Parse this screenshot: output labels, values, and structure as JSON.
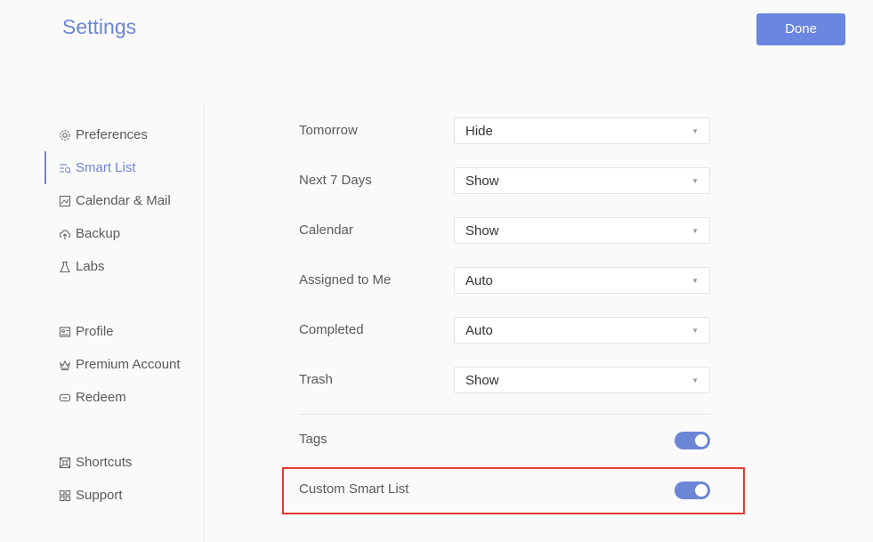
{
  "header": {
    "title": "Settings",
    "done_label": "Done"
  },
  "sidebar": {
    "items": [
      {
        "label": "Preferences",
        "icon": "gear-icon"
      },
      {
        "label": "Smart List",
        "icon": "smart-list-icon",
        "active": true
      },
      {
        "label": "Calendar & Mail",
        "icon": "calendar-mail-icon"
      },
      {
        "label": "Backup",
        "icon": "cloud-backup-icon"
      },
      {
        "label": "Labs",
        "icon": "flask-icon"
      },
      {
        "label": "Profile",
        "icon": "profile-card-icon"
      },
      {
        "label": "Premium Account",
        "icon": "crown-icon"
      },
      {
        "label": "Redeem",
        "icon": "ticket-icon"
      },
      {
        "label": "Shortcuts",
        "icon": "command-key-icon"
      },
      {
        "label": "Support",
        "icon": "grid-support-icon"
      }
    ]
  },
  "main": {
    "rows": [
      {
        "label": "Tomorrow",
        "value": "Hide"
      },
      {
        "label": "Next 7 Days",
        "value": "Show"
      },
      {
        "label": "Calendar",
        "value": "Show"
      },
      {
        "label": "Assigned to Me",
        "value": "Auto"
      },
      {
        "label": "Completed",
        "value": "Auto"
      },
      {
        "label": "Trash",
        "value": "Show"
      }
    ],
    "toggles": [
      {
        "label": "Tags",
        "on": true
      },
      {
        "label": "Custom Smart List",
        "on": true
      }
    ]
  },
  "colors": {
    "accent": "#6b86d6",
    "highlight": "#e53935"
  }
}
